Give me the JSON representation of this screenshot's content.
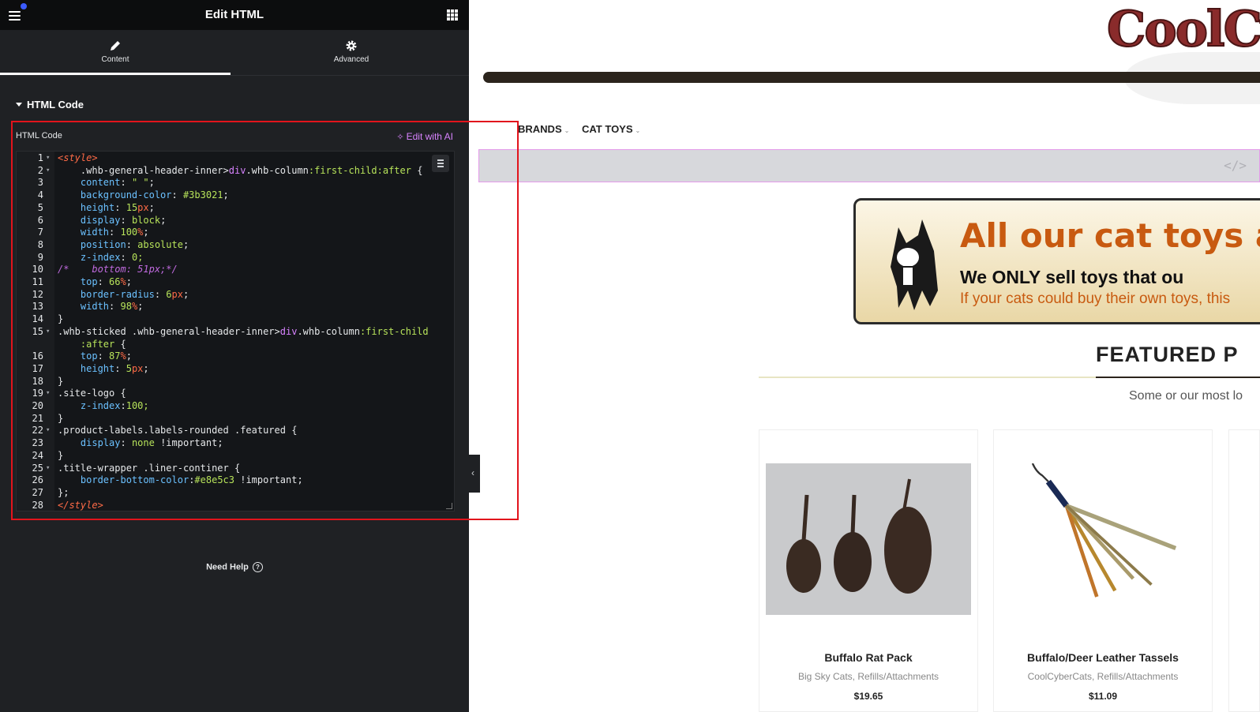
{
  "editor": {
    "title": "Edit HTML",
    "tabs": [
      {
        "label": "Content",
        "icon": "pencil-icon",
        "active": true
      },
      {
        "label": "Advanced",
        "icon": "gear-icon",
        "active": false
      }
    ],
    "section_title": "HTML Code",
    "field_label": "HTML Code",
    "ai_button": "Edit with AI",
    "code_lines": [
      "<style>",
      "    .whb-general-header-inner>div.whb-column:first-child:after {",
      "    content: \" \";",
      "    background-color: #3b3021;",
      "    height: 15px;",
      "    display: block;",
      "    width: 100%;",
      "    position: absolute;",
      "    z-index: 0;",
      "/*    bottom: 51px;*/",
      "    top: 66%;",
      "    border-radius: 6px;",
      "    width: 98%;",
      "}",
      ".whb-sticked .whb-general-header-inner>div.whb-column:first-child",
      "    :after {",
      "    top: 87%;",
      "    height: 5px;",
      "}",
      ".site-logo {",
      "    z-index:100;",
      "}",
      ".product-labels.labels-rounded .featured {",
      "    display: none !important;",
      "}",
      ".title-wrapper .liner-continer {",
      "    border-bottom-color:#e8e5c3 !important;",
      "};",
      "</style>"
    ],
    "line_numbers": [
      "1",
      "2",
      "3",
      "4",
      "5",
      "6",
      "7",
      "8",
      "9",
      "10",
      "11",
      "12",
      "13",
      "14",
      "15",
      "",
      "16",
      "17",
      "18",
      "19",
      "20",
      "21",
      "22",
      "23",
      "24",
      "25",
      "26",
      "27",
      "28"
    ],
    "help_label": "Need Help",
    "accent_color": "#d883ff"
  },
  "preview": {
    "logo_text": "CoolCybe",
    "nav": [
      {
        "label": "BRANDS"
      },
      {
        "label": "CAT TOYS"
      }
    ],
    "banner": {
      "headline": "All our cat toys ar",
      "line2": "We ONLY sell toys that ou",
      "line3": "If your cats could buy their own toys, this"
    },
    "section_title": "FEATURED P",
    "section_subtitle": "Some or our most lo",
    "products": [
      {
        "name": "Buffalo Rat Pack",
        "categories": "Big Sky Cats, Refills/Attachments",
        "price": "$19.65"
      },
      {
        "name": "Buffalo/Deer Leather Tassels",
        "categories": "CoolCyberCats, Refills/Attachments",
        "price": "$11.09"
      }
    ],
    "header_bar_color": "#3b3021",
    "title_line_color": "#e8e5c3"
  }
}
